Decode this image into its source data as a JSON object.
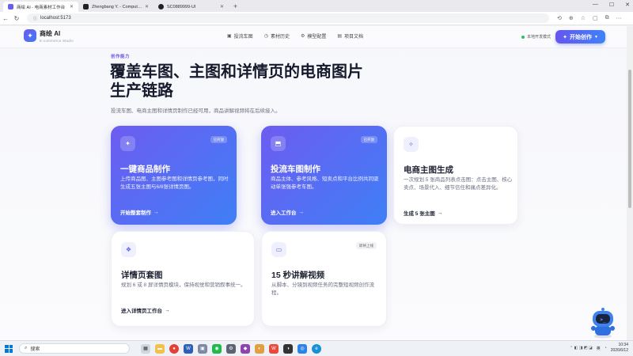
{
  "browser": {
    "tabs": [
      {
        "title": "商绘 AI - 电商素材工作台",
        "color": "#6b5cf0",
        "active": true
      },
      {
        "title": "Zhengbang Y. - Computer Science",
        "color": "#222222",
        "active": false
      },
      {
        "title": "SC0889999-UI",
        "color": "#222222",
        "active": false
      }
    ],
    "new_tab": "+",
    "url": "localhost:5173",
    "window_controls": [
      "—",
      "☐",
      "✕"
    ]
  },
  "header": {
    "logo_glyph": "✦",
    "brand_name": "商绘 AI",
    "brand_sub": "E-commerce Studio",
    "nav": [
      {
        "icon": "image-icon",
        "glyph": "▣",
        "label": "投流车图"
      },
      {
        "icon": "history-icon",
        "glyph": "◷",
        "label": "素材历史"
      },
      {
        "icon": "model-icon",
        "glyph": "⚙",
        "label": "模型配置"
      },
      {
        "icon": "doc-icon",
        "glyph": "▤",
        "label": "项目文档"
      }
    ],
    "mode_label": "本地开发模式",
    "start_button": "开始创作"
  },
  "hero": {
    "eyebrow": "创作能力",
    "title": "覆盖车图、主图和详情页的电商图片生产链路",
    "description": "投流车图、电商主图和详情页制作已经可用，商品讲解视频将在后续接入。"
  },
  "cards": [
    {
      "id": "one-click",
      "title": "一键商品制作",
      "badge": "已开放",
      "desc": "上传商品图、主图参考图和详情页参考图，同时生成五张主图与6/8张详情页图。",
      "link": "开始整套制作",
      "icon": "sparkle-icon",
      "glyph": "✦"
    },
    {
      "id": "ad-image",
      "title": "投流车图制作",
      "badge": "已开放",
      "desc": "商品主体、参考风格、短卖点和平台比例共同驱动单张强参考车图。",
      "link": "进入工作台",
      "icon": "image-edit-icon",
      "glyph": "⬒"
    },
    {
      "id": "main-image",
      "title": "电商主图生成",
      "badge": "",
      "desc": "一次规划 5 张商品列表点击图：点击主图、核心卖点、场景代入、细节信任和痛点差异化。",
      "link": "生成 5 张主图",
      "icon": "magic-icon",
      "glyph": "✧"
    },
    {
      "id": "detail-page",
      "title": "详情页套图",
      "badge": "",
      "desc": "规划 6 或 8 屏详情页模块，保持视觉和营销叙事统一。",
      "link": "进入详情页工作台",
      "icon": "layers-icon",
      "glyph": "❖"
    },
    {
      "id": "video",
      "title": "15 秒讲解视频",
      "badge": "即将上线",
      "desc": "从脚本、分镜到视频任务的完整短视频创作流程。",
      "link": "",
      "icon": "video-icon",
      "glyph": "▭"
    }
  ],
  "taskbar": {
    "search_placeholder": "搜索",
    "time": "10:34",
    "date": "2026/6/12",
    "lang": "英"
  }
}
